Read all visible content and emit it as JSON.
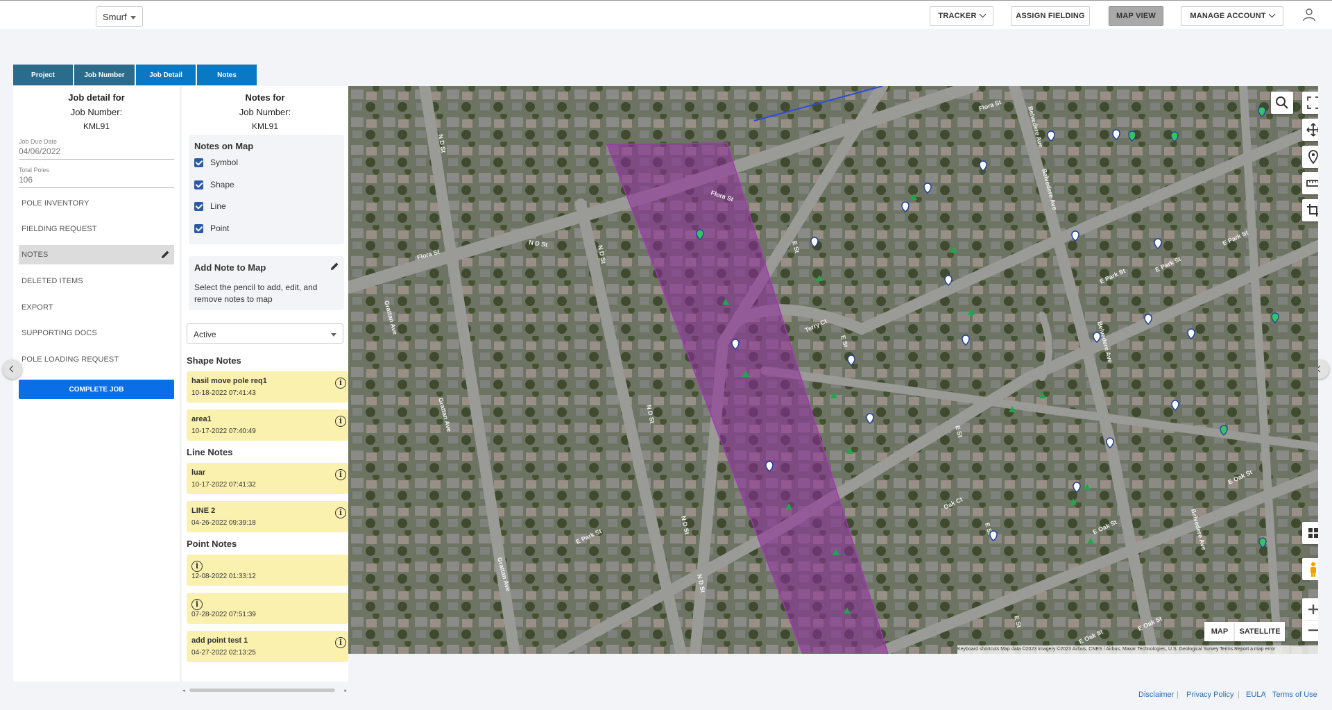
{
  "header": {
    "org_select": "Smurf",
    "nav": {
      "tracker": "TRACKER",
      "assign_fielding": "ASSIGN FIELDING",
      "map_view": "MAP VIEW",
      "manage_account": "MANAGE ACCOUNT"
    }
  },
  "tabs": [
    "Project",
    "Job Number",
    "Job Detail",
    "Notes"
  ],
  "job_panel": {
    "title": "Job detail for",
    "job_number_label": "Job Number:",
    "job_number": "KML91",
    "due_label": "Job Due Date",
    "due_value": "04/06/2022",
    "poles_label": "Total Poles",
    "poles_value": "106",
    "menu": [
      "POLE INVENTORY",
      "FIELDING REQUEST",
      "NOTES",
      "DELETED ITEMS",
      "EXPORT",
      "SUPPORTING DOCS",
      "POLE LOADING REQUEST"
    ],
    "complete_button": "COMPLETE JOB"
  },
  "notes_panel": {
    "title": "Notes for",
    "job_number_label": "Job Number:",
    "job_number": "KML91",
    "notes_on_map_title": "Notes on Map",
    "checkboxes": [
      "Symbol",
      "Shape",
      "Line",
      "Point"
    ],
    "add_note_title": "Add Note to Map",
    "add_note_desc": "Select the pencil to add, edit, and remove notes to map",
    "status_select": "Active",
    "shape_notes_title": "Shape Notes",
    "shape_notes": [
      {
        "title": "hasil move pole req1",
        "date": "10-18-2022 07:41:43"
      },
      {
        "title": "area1",
        "date": "10-17-2022 07:40:49"
      }
    ],
    "line_notes_title": "Line Notes",
    "line_notes": [
      {
        "title": "luar",
        "date": "10-17-2022 07:41:32"
      },
      {
        "title": "LINE 2",
        "date": "04-26-2022 09:39:18"
      }
    ],
    "point_notes_title": "Point Notes",
    "point_notes": [
      {
        "title": "",
        "date": "12-08-2022 01:33:12"
      },
      {
        "title": "",
        "date": "07-28-2022 07:51:39"
      },
      {
        "title": "add point test 1",
        "date": "04-27-2022 02:13:25"
      }
    ]
  },
  "map": {
    "type_map": "MAP",
    "type_satellite": "SATELLITE",
    "attribution": "Keyboard shortcuts    Map data ©2023 Imagery ©2023 Airbus, CNES / Airbus, Maxar Technologies, U.S. Geological Survey    Terms    Report a map error",
    "streets": [
      "Flora St",
      "N D St",
      "N D St",
      "N D St",
      "N D St",
      "Grattan Ave",
      "Grattan Ave",
      "Grattan Ave",
      "Flora St",
      "Flora St",
      "E St",
      "E St",
      "E St",
      "E St",
      "Terry Ct",
      "Oak Ct",
      "E Park St",
      "E Park St",
      "E Park St",
      "E Oak St",
      "E Oak St",
      "E Oak St",
      "Belvedere Ave",
      "Belvedere Ave",
      "Belvedere Ave",
      "Belvedere Ave",
      "E Park St"
    ],
    "polygon_color": "#8e2a9c"
  },
  "footer": [
    "Disclaimer",
    "Privacy Policy",
    "EULA",
    "Terms of Use"
  ],
  "colors": {
    "tab_dark": "#2b6b8c",
    "tab_blue": "#0a78c2",
    "primary": "#0a6ee6",
    "note_bg": "#fbf1ae"
  }
}
